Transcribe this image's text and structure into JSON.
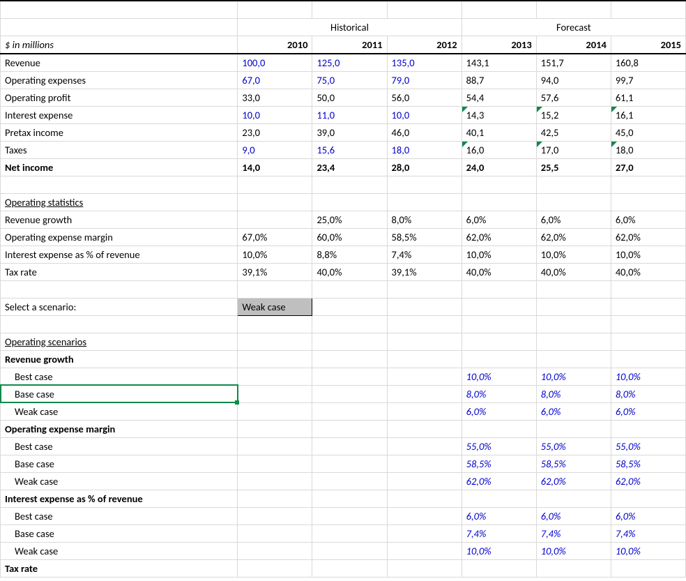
{
  "headers": {
    "historical": "Historical",
    "forecast": "Forecast",
    "unit": "$ in millions"
  },
  "years": {
    "y10": "2010",
    "y11": "2011",
    "y12": "2012",
    "y13": "2013",
    "y14": "2014",
    "y15": "2015"
  },
  "labels": {
    "revenue": "Revenue",
    "opex": "Operating expenses",
    "opprofit": "Operating profit",
    "intexp": "Interest expense",
    "pretax": "Pretax income",
    "taxes": "Taxes",
    "netinc": "Net income",
    "opstats": "Operating statistics",
    "revgrowth": "Revenue growth",
    "opexmargin": "Operating expense margin",
    "intpct": "Interest expense as % of revenue",
    "taxrate": "Tax rate",
    "selectscen": "Select a scenario:",
    "opscen": "Operating scenarios",
    "best": "Best case",
    "base": "Base case",
    "weak": "Weak case"
  },
  "scenario_selected": "Weak case",
  "data": {
    "revenue": {
      "y10": "100,0",
      "y11": "125,0",
      "y12": "135,0",
      "y13": "143,1",
      "y14": "151,7",
      "y15": "160,8"
    },
    "opex": {
      "y10": "67,0",
      "y11": "75,0",
      "y12": "79,0",
      "y13": "88,7",
      "y14": "94,0",
      "y15": "99,7"
    },
    "opprofit": {
      "y10": "33,0",
      "y11": "50,0",
      "y12": "56,0",
      "y13": "54,4",
      "y14": "57,6",
      "y15": "61,1"
    },
    "intexp": {
      "y10": "10,0",
      "y11": "11,0",
      "y12": "10,0",
      "y13": "14,3",
      "y14": "15,2",
      "y15": "16,1"
    },
    "pretax": {
      "y10": "23,0",
      "y11": "39,0",
      "y12": "46,0",
      "y13": "40,1",
      "y14": "42,5",
      "y15": "45,0"
    },
    "taxes": {
      "y10": "9,0",
      "y11": "15,6",
      "y12": "18,0",
      "y13": "16,0",
      "y14": "17,0",
      "y15": "18,0"
    },
    "netinc": {
      "y10": "14,0",
      "y11": "23,4",
      "y12": "28,0",
      "y13": "24,0",
      "y14": "25,5",
      "y15": "27,0"
    },
    "revgrowth": {
      "y10": "",
      "y11": "25,0%",
      "y12": "8,0%",
      "y13": "6,0%",
      "y14": "6,0%",
      "y15": "6,0%"
    },
    "opexmargin": {
      "y10": "67,0%",
      "y11": "60,0%",
      "y12": "58,5%",
      "y13": "62,0%",
      "y14": "62,0%",
      "y15": "62,0%"
    },
    "intpct": {
      "y10": "10,0%",
      "y11": "8,8%",
      "y12": "7,4%",
      "y13": "10,0%",
      "y14": "10,0%",
      "y15": "10,0%"
    },
    "taxrate": {
      "y10": "39,1%",
      "y11": "40,0%",
      "y12": "39,1%",
      "y13": "40,0%",
      "y14": "40,0%",
      "y15": "40,0%"
    }
  },
  "scenarios": {
    "revgrowth": {
      "best": {
        "y13": "10,0%",
        "y14": "10,0%",
        "y15": "10,0%"
      },
      "base": {
        "y13": "8,0%",
        "y14": "8,0%",
        "y15": "8,0%"
      },
      "weak": {
        "y13": "6,0%",
        "y14": "6,0%",
        "y15": "6,0%"
      }
    },
    "opexmargin": {
      "best": {
        "y13": "55,0%",
        "y14": "55,0%",
        "y15": "55,0%"
      },
      "base": {
        "y13": "58,5%",
        "y14": "58,5%",
        "y15": "58,5%"
      },
      "weak": {
        "y13": "62,0%",
        "y14": "62,0%",
        "y15": "62,0%"
      }
    },
    "intpct": {
      "best": {
        "y13": "6,0%",
        "y14": "6,0%",
        "y15": "6,0%"
      },
      "base": {
        "y13": "7,4%",
        "y14": "7,4%",
        "y15": "7,4%"
      },
      "weak": {
        "y13": "10,0%",
        "y14": "10,0%",
        "y15": "10,0%"
      }
    }
  }
}
